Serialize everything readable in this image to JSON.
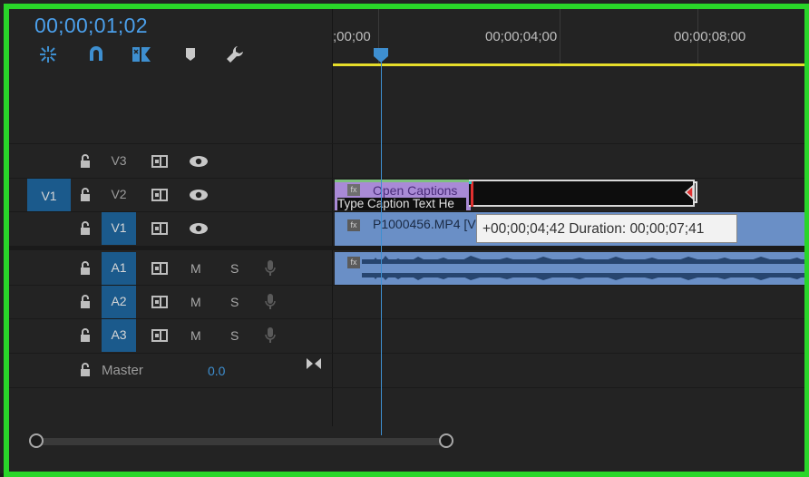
{
  "timecode": "00;00;01;02",
  "ruler": {
    "labels": [
      ";00;00",
      "00;00;04;00",
      "00;00;08;00"
    ]
  },
  "tracks": {
    "video": [
      {
        "name": "V3",
        "source_label": ""
      },
      {
        "name": "V2",
        "source_label": "V1"
      },
      {
        "name": "V1",
        "source_label": ""
      }
    ],
    "audio": [
      {
        "name": "A1",
        "m": "M",
        "s": "S"
      },
      {
        "name": "A2",
        "m": "M",
        "s": "S"
      },
      {
        "name": "A3",
        "m": "M",
        "s": "S"
      }
    ],
    "master": {
      "label": "Master",
      "value": "0.0"
    }
  },
  "clips": {
    "caption_clip_title": "Open Captions",
    "caption_clip_text": "Type Caption Text He",
    "video_clip_title": "P1000456.MP4 [V",
    "fx_label": "fx"
  },
  "tooltip": "+00;00;04;42 Duration: 00;00;07;41",
  "colors": {
    "accent_blue": "#4b9fea",
    "frame_border": "#29d629",
    "timebar_yellow": "#e6dd2a",
    "track_target": "#1b5a8c",
    "video_clip": "#6a8fc6",
    "caption_clip": "#a98ad6"
  },
  "icons": [
    "snap-nest-icon",
    "magnet-icon",
    "linked-selection-icon",
    "marker-icon",
    "wrench-icon",
    "lock-icon",
    "toggle-sync-icon",
    "eye-icon",
    "mic-icon",
    "fit-timeline-icon"
  ]
}
